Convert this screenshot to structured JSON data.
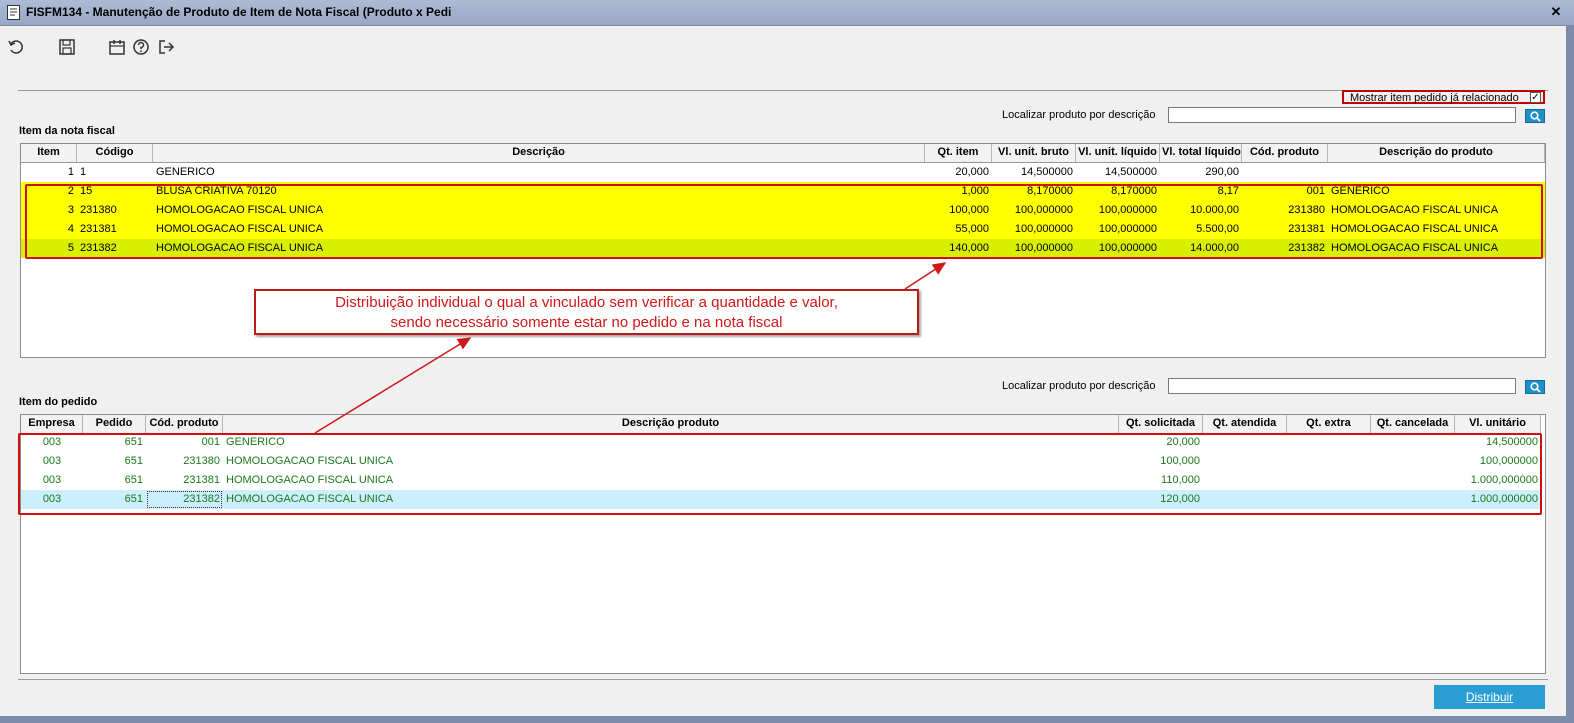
{
  "window": {
    "title": "FISFM134 - Manutenção de Produto de Item de Nota Fiscal (Produto x Pedi",
    "close_glyph": "✕"
  },
  "toolbar": {
    "icons": [
      "undo-icon",
      "save-icon",
      "calendar-icon",
      "help-icon",
      "exit-icon"
    ]
  },
  "options": {
    "show_related_label": "Mostrar item pedido já relacionado",
    "show_related_checked": true
  },
  "search_nf": {
    "label": "Localizar produto por descrição",
    "value": ""
  },
  "search_pedido": {
    "label": "Localizar produto por descrição",
    "value": ""
  },
  "nota_fiscal": {
    "section_label": "Item da nota fiscal",
    "columns": [
      "Item",
      "Código",
      "Descrição",
      "Qt. item",
      "Vl. unit. bruto",
      "Vl. unit. líquido",
      "Vl. total líquido",
      "Cód. produto",
      "Descrição do produto"
    ],
    "rows": [
      [
        "1",
        "1",
        "GENERICO",
        "20,000",
        "14,500000",
        "14,500000",
        "290,00",
        "",
        ""
      ],
      [
        "2",
        "15",
        "BLUSA CRIATIVA 70120",
        "1,000",
        "8,170000",
        "8,170000",
        "8,17",
        "001",
        "GENERICO"
      ],
      [
        "3",
        "231380",
        "HOMOLOGACAO FISCAL UNICA",
        "100,000",
        "100,000000",
        "100,000000",
        "10.000,00",
        "231380",
        "HOMOLOGACAO FISCAL UNICA"
      ],
      [
        "4",
        "231381",
        "HOMOLOGACAO FISCAL UNICA",
        "55,000",
        "100,000000",
        "100,000000",
        "5.500,00",
        "231381",
        "HOMOLOGACAO FISCAL UNICA"
      ],
      [
        "5",
        "231382",
        "HOMOLOGACAO FISCAL UNICA",
        "140,000",
        "100,000000",
        "100,000000",
        "14.000,00",
        "231382",
        "HOMOLOGACAO FISCAL UNICA"
      ]
    ]
  },
  "pedido": {
    "section_label": "Item do pedido",
    "columns": [
      "Empresa",
      "Pedido",
      "Cód. produto",
      "Descrição produto",
      "Qt. solicitada",
      "Qt. atendida",
      "Qt. extra",
      "Qt. cancelada",
      "Vl. unitário"
    ],
    "rows": [
      [
        "003",
        "651",
        "001",
        "GENERICO",
        "20,000",
        "",
        "",
        "",
        "14,500000"
      ],
      [
        "003",
        "651",
        "231380",
        "HOMOLOGACAO FISCAL UNICA",
        "100,000",
        "",
        "",
        "",
        "100,000000"
      ],
      [
        "003",
        "651",
        "231381",
        "HOMOLOGACAO FISCAL UNICA",
        "110,000",
        "",
        "",
        "",
        "1.000,000000"
      ],
      [
        "003",
        "651",
        "231382",
        "HOMOLOGACAO FISCAL UNICA",
        "120,000",
        "",
        "",
        "",
        "1.000,000000"
      ]
    ]
  },
  "annotation": {
    "line1": "Distribuição individual o qual a vinculado sem verificar a quantidade e valor,",
    "line2": "sendo necessário somente estar no pedido e na nota fiscal"
  },
  "footer": {
    "distribuir_label": "Distribuir"
  },
  "colors": {
    "highlight_yellow": "#ffff00",
    "highlight_lime": "#d8f000",
    "selected_row": "#cdeefc",
    "accent_blue": "#2a9ed3",
    "annotation_red": "#d01818",
    "pedido_text_green": "#1a7a1a"
  }
}
